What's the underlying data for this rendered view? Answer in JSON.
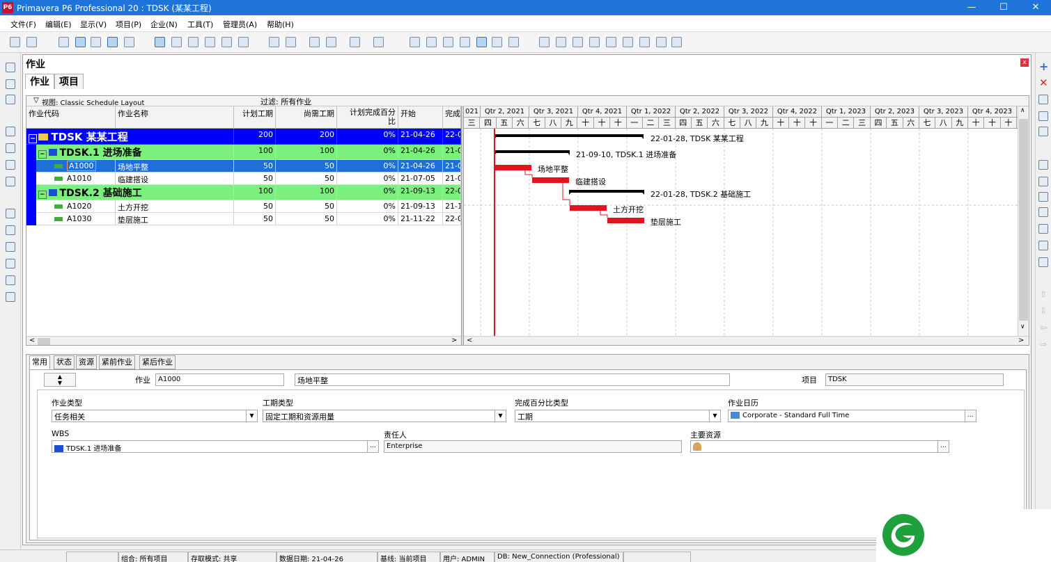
{
  "window": {
    "title": "Primavera P6 Professional 20 : TDSK (某某工程)",
    "logo_text": "P6",
    "minimize": "—",
    "maximize": "☐",
    "close": "✕"
  },
  "menu": [
    "文件(F)",
    "编辑(E)",
    "显示(V)",
    "项目(P)",
    "企业(N)",
    "工具(T)",
    "管理员(A)",
    "帮助(H)"
  ],
  "panel": {
    "title": "作业",
    "close": "x",
    "tabs": [
      "作业",
      "项目"
    ]
  },
  "view": {
    "label": "视图: Classic Schedule Layout",
    "filter": "过滤: 所有作业"
  },
  "columns": {
    "code": "作业代码",
    "name": "作业名称",
    "planned": "计划工期",
    "remaining": "尚需工期",
    "pct1": "计划完成百分",
    "pct2": "比",
    "start": "开始",
    "finish": "完成"
  },
  "rows": [
    {
      "code": "TDSK",
      "name": "某某工程",
      "planned": "200",
      "remaining": "200",
      "pct": "0%",
      "start": "21-04-26",
      "finish": "22-01"
    },
    {
      "code": "TDSK.1",
      "name": "进场准备",
      "planned": "100",
      "remaining": "100",
      "pct": "0%",
      "start": "21-04-26",
      "finish": "21-09"
    },
    {
      "code": "A1000",
      "name": "场地平整",
      "planned": "50",
      "remaining": "50",
      "pct": "0%",
      "start": "21-04-26",
      "finish": "21-06"
    },
    {
      "code": "A1010",
      "name": "临建搭设",
      "planned": "50",
      "remaining": "50",
      "pct": "0%",
      "start": "21-07-05",
      "finish": "21-09"
    },
    {
      "code": "TDSK.2",
      "name": "基础施工",
      "planned": "100",
      "remaining": "100",
      "pct": "0%",
      "start": "21-09-13",
      "finish": "22-01"
    },
    {
      "code": "A1020",
      "name": "土方开挖",
      "planned": "50",
      "remaining": "50",
      "pct": "0%",
      "start": "21-09-13",
      "finish": "21-11"
    },
    {
      "code": "A1030",
      "name": "垫层施工",
      "planned": "50",
      "remaining": "50",
      "pct": "0%",
      "start": "21-11-22",
      "finish": "22-01"
    }
  ],
  "timeline": {
    "quarters": [
      "021",
      "Qtr 2, 2021",
      "Qtr 3, 2021",
      "Qtr 4, 2021",
      "Qtr 1, 2022",
      "Qtr 2, 2022",
      "Qtr 3, 2022",
      "Qtr 4, 2022",
      "Qtr 1, 2023",
      "Qtr 2, 2023",
      "Qtr 3, 2023",
      "Qtr 4, 2023"
    ],
    "months": [
      "三",
      "四",
      "五",
      "六",
      "七",
      "八",
      "九",
      "十",
      "十",
      "十",
      "一",
      "二",
      "三",
      "四",
      "五",
      "六",
      "七",
      "八",
      "九",
      "十",
      "十",
      "十",
      "一",
      "二",
      "三",
      "四",
      "五",
      "六",
      "七",
      "八",
      "九",
      "十",
      "十",
      "十"
    ]
  },
  "gantt_labels": [
    "22-01-28, TDSK  某某工程",
    "21-09-10, TDSK.1  进场准备",
    "场地平整",
    "临建搭设",
    "22-01-28, TDSK.2  基础施工",
    "土方开挖",
    "垫层施工"
  ],
  "detail": {
    "tabs": [
      "常用",
      "状态",
      "资源",
      "紧前作业",
      "紧后作业"
    ],
    "activity_label": "作业",
    "activity_code": "A1000",
    "activity_name": "场地平整",
    "project_label": "项目",
    "project_value": "TDSK",
    "type_label": "作业类型",
    "type_value": "任务相关",
    "duration_type_label": "工期类型",
    "duration_type_value": "固定工期和资源用量",
    "pct_type_label": "完成百分比类型",
    "pct_type_value": "工期",
    "calendar_label": "作业日历",
    "calendar_value": "Corporate - Standard Full Time",
    "wbs_label": "WBS",
    "wbs_value": "TDSK.1  进场准备",
    "owner_label": "责任人",
    "owner_value": "Enterprise",
    "resource_label": "主要资源",
    "resource_value": ""
  },
  "status": {
    "group": "组合: 所有项目",
    "access": "存取模式: 共享",
    "data_date": "数据日期: 21-04-26",
    "baseline": "基线: 当前项目",
    "user": "用户: ADMIN",
    "db": "DB: New_Connection (Professional)"
  },
  "colors": {
    "title": "#1f74d9",
    "project": "#0000ff",
    "wbs": "#7cf07c",
    "selected": "#1e6fd9",
    "bar": "#e0141e",
    "summary": "#000000"
  }
}
